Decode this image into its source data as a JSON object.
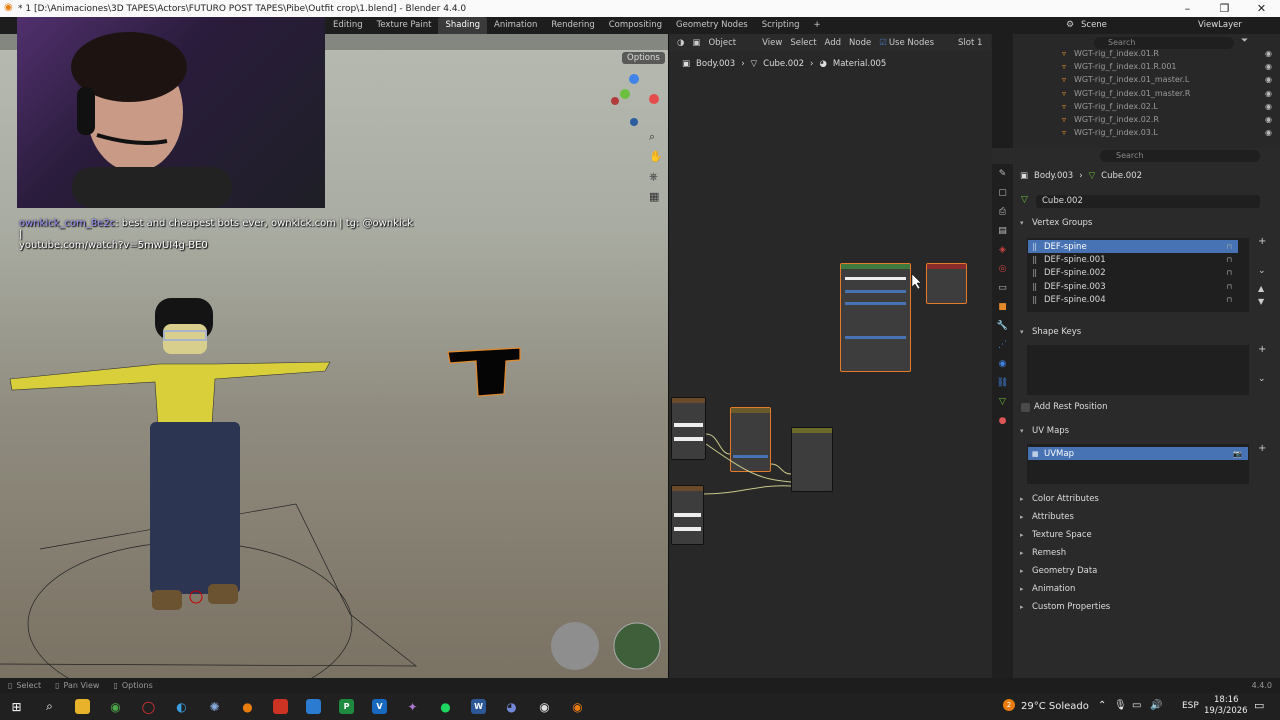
{
  "titlebar": {
    "title": "* 1 [D:\\Animaciones\\3D TAPES\\Actors\\FUTURO POST TAPES\\Pibe\\Outfit crop\\1.blend] - Blender 4.4.0"
  },
  "workspaces": [
    "Editing",
    "Texture Paint",
    "Shading",
    "Animation",
    "Rendering",
    "Compositing",
    "Geometry Nodes",
    "Scripting"
  ],
  "scene": {
    "label": "Scene",
    "view_layer": "ViewLayer"
  },
  "viewport": {
    "options_label": "Options"
  },
  "chat": {
    "user": "ownkick_com_8e2c",
    "message": ": best and cheapest bots ever, ownkick.com | tg: @ownkick |",
    "line2": "youtube.com/watch?v=5mwUI4g-BE0"
  },
  "node_editor": {
    "mode": "Object",
    "menu": [
      "View",
      "Select",
      "Add",
      "Node"
    ],
    "use_nodes": "Use Nodes",
    "slot": "Slot 1",
    "breadcrumb": [
      "Body.003",
      "Cube.002",
      "Material.005"
    ]
  },
  "outliner": {
    "search_placeholder": "Search",
    "items": [
      "WGT-rig_f_index.01.R",
      "WGT-rig_f_index.01.R.001",
      "WGT-rig_f_index.01_master.L",
      "WGT-rig_f_index.01_master.R",
      "WGT-rig_f_index.02.L",
      "WGT-rig_f_index.02.R",
      "WGT-rig_f_index.03.L"
    ]
  },
  "properties": {
    "search_placeholder": "Search",
    "breadcrumb": [
      "Body.003",
      "Cube.002"
    ],
    "data_name": "Cube.002",
    "vertex_groups_label": "Vertex Groups",
    "vertex_groups": [
      "DEF-spine",
      "DEF-spine.001",
      "DEF-spine.002",
      "DEF-spine.003",
      "DEF-spine.004"
    ],
    "shape_keys_label": "Shape Keys",
    "add_rest_position": "Add Rest Position",
    "uv_maps_label": "UV Maps",
    "uv_map": "UVMap",
    "collapsed": [
      "Color Attributes",
      "Attributes",
      "Texture Space",
      "Remesh",
      "Geometry Data",
      "Animation",
      "Custom Properties"
    ]
  },
  "statusbar": {
    "select": "Select",
    "pan": "Pan View",
    "options": "Options",
    "version": "4.4.0"
  },
  "taskbar": {
    "weather": "29°C Soleado",
    "lang": "ESP",
    "time": "18:16",
    "date": "19/3/2026",
    "badge": "2"
  }
}
